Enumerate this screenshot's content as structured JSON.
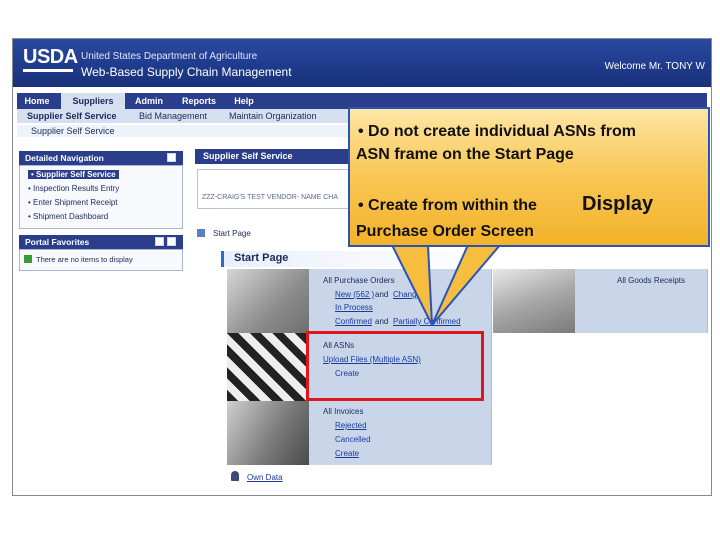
{
  "header": {
    "logo": "USDA",
    "department": "United States Department of Agriculture",
    "app_title": "Web-Based Supply Chain Management",
    "welcome": "Welcome Mr. TONY W"
  },
  "top_nav": [
    "Home",
    "Suppliers",
    "Admin",
    "Reports",
    "Help"
  ],
  "sub_nav": [
    "Supplier Self Service",
    "Bid Management",
    "Maintain Organization"
  ],
  "page_bar_title": "Supplier Self Service",
  "left": {
    "detailed_nav_title": "Detailed Navigation",
    "nav_items": [
      "Supplier Self Service",
      "Inspection Results Entry",
      "Enter Shipment Receipt",
      "Shipment Dashboard"
    ],
    "portal_favorites_title": "Portal Favorites",
    "favorites_empty": "There are no items to display"
  },
  "main": {
    "header_title": "Supplier Self Service",
    "vendor_name": "ZZZ-CRAIG'S TEST VENDOR- NAME CHA",
    "breadcrumb": "Start Page",
    "start_page_title": "Start Page",
    "purchase_orders": {
      "title": "All Purchase Orders",
      "new": "New",
      "new_count": "(562 )",
      "and1": "and",
      "changed": "Chang",
      "in_process": "In Process",
      "confirmed": "Confirmed",
      "and2": "and",
      "partially": "Partially Confirmed"
    },
    "goods_receipts": {
      "title": "All Goods Receipts"
    },
    "asns": {
      "title": "All ASNs",
      "upload": "Upload Files (Multiple ASN)",
      "create": "Create"
    },
    "invoices": {
      "title": "All Invoices",
      "rejected": "Rejected",
      "cancelled": "Cancelled",
      "create": "Create"
    },
    "own_data": "Own Data"
  },
  "callout": {
    "line1": "• Do not create individual ASNs from",
    "line2": "ASN frame on the Start Page",
    "line3a": "• Create from within the",
    "line3b": "Display",
    "line4": "Purchase Order Screen"
  },
  "colors": {
    "nav_blue": "#2b3e8c",
    "callout_border": "#2a54b8",
    "callout_fill": "#f9c95a",
    "highlight_red": "#e0161e"
  }
}
